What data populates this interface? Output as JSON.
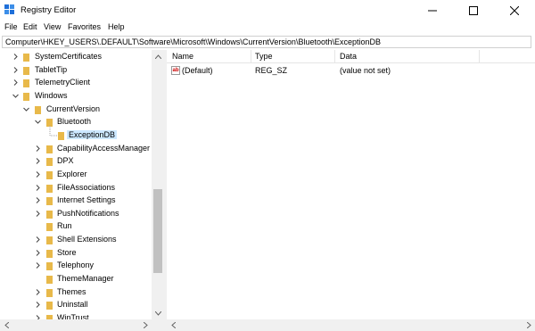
{
  "window": {
    "title": "Registry Editor",
    "icons": {
      "app": "registry-editor-icon",
      "minimize": "minimize-icon",
      "maximize": "maximize-icon",
      "close": "close-icon"
    }
  },
  "menu": [
    "File",
    "Edit",
    "View",
    "Favorites",
    "Help"
  ],
  "address": "Computer\\HKEY_USERS\\.DEFAULT\\Software\\Microsoft\\Windows\\CurrentVersion\\Bluetooth\\ExceptionDB",
  "tree": [
    {
      "label": "SystemCertificates",
      "depth": 1,
      "chevron": "right"
    },
    {
      "label": "TabletTip",
      "depth": 1,
      "chevron": "right"
    },
    {
      "label": "TelemetryClient",
      "depth": 1,
      "chevron": "right"
    },
    {
      "label": "Windows",
      "depth": 1,
      "chevron": "down"
    },
    {
      "label": "CurrentVersion",
      "depth": 2,
      "chevron": "down"
    },
    {
      "label": "Bluetooth",
      "depth": 3,
      "chevron": "down"
    },
    {
      "label": "ExceptionDB",
      "depth": 4,
      "chevron": "none",
      "selected": true
    },
    {
      "label": "CapabilityAccessManager",
      "depth": 3,
      "chevron": "right"
    },
    {
      "label": "DPX",
      "depth": 3,
      "chevron": "right"
    },
    {
      "label": "Explorer",
      "depth": 3,
      "chevron": "right"
    },
    {
      "label": "FileAssociations",
      "depth": 3,
      "chevron": "right"
    },
    {
      "label": "Internet Settings",
      "depth": 3,
      "chevron": "right"
    },
    {
      "label": "PushNotifications",
      "depth": 3,
      "chevron": "right"
    },
    {
      "label": "Run",
      "depth": 3,
      "chevron": "none"
    },
    {
      "label": "Shell Extensions",
      "depth": 3,
      "chevron": "right"
    },
    {
      "label": "Store",
      "depth": 3,
      "chevron": "right"
    },
    {
      "label": "Telephony",
      "depth": 3,
      "chevron": "right"
    },
    {
      "label": "ThemeManager",
      "depth": 3,
      "chevron": "none"
    },
    {
      "label": "Themes",
      "depth": 3,
      "chevron": "right"
    },
    {
      "label": "Uninstall",
      "depth": 3,
      "chevron": "right"
    },
    {
      "label": "WinTrust",
      "depth": 3,
      "chevron": "right"
    }
  ],
  "columns": {
    "name": "Name",
    "type": "Type",
    "data": "Data"
  },
  "values": [
    {
      "name": "(Default)",
      "type": "REG_SZ",
      "data": "(value not set)",
      "icon": "string-value-icon"
    }
  ],
  "colors": {
    "selection": "#cce8ff",
    "folder": "#e8b94a",
    "scroll_thumb": "#c1c1c1"
  }
}
